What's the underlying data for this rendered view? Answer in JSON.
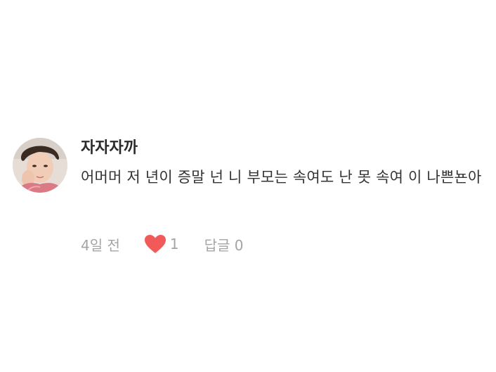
{
  "comment": {
    "username": "자자자까",
    "text": "어머머 저 년이 증말 넌 니 부모는 속여도 난 못 속여 이 나쁜뇬아",
    "timestamp": "4일 전",
    "like_icon": "heart-icon",
    "like_count": "1",
    "reply_label": "답글 0",
    "avatar_icon": "user-avatar"
  },
  "colors": {
    "heart": "#f25a5a",
    "meta_text": "#a4a4a4",
    "username_text": "#2b2b2b",
    "body_text": "#333333"
  }
}
